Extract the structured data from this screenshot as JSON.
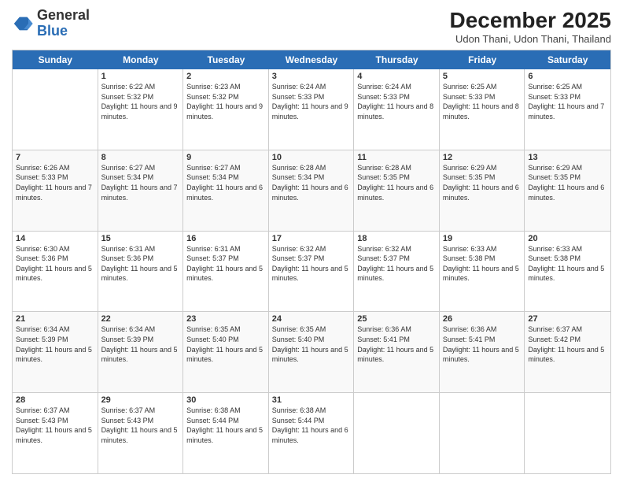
{
  "logo": {
    "general": "General",
    "blue": "Blue"
  },
  "header": {
    "month": "December 2025",
    "location": "Udon Thani, Udon Thani, Thailand"
  },
  "days": [
    "Sunday",
    "Monday",
    "Tuesday",
    "Wednesday",
    "Thursday",
    "Friday",
    "Saturday"
  ],
  "weeks": [
    [
      {
        "num": "",
        "sunrise": "",
        "sunset": "",
        "daylight": ""
      },
      {
        "num": "1",
        "sunrise": "6:22 AM",
        "sunset": "5:32 PM",
        "daylight": "11 hours and 9 minutes."
      },
      {
        "num": "2",
        "sunrise": "6:23 AM",
        "sunset": "5:32 PM",
        "daylight": "11 hours and 9 minutes."
      },
      {
        "num": "3",
        "sunrise": "6:24 AM",
        "sunset": "5:33 PM",
        "daylight": "11 hours and 9 minutes."
      },
      {
        "num": "4",
        "sunrise": "6:24 AM",
        "sunset": "5:33 PM",
        "daylight": "11 hours and 8 minutes."
      },
      {
        "num": "5",
        "sunrise": "6:25 AM",
        "sunset": "5:33 PM",
        "daylight": "11 hours and 8 minutes."
      },
      {
        "num": "6",
        "sunrise": "6:25 AM",
        "sunset": "5:33 PM",
        "daylight": "11 hours and 7 minutes."
      }
    ],
    [
      {
        "num": "7",
        "sunrise": "6:26 AM",
        "sunset": "5:33 PM",
        "daylight": "11 hours and 7 minutes."
      },
      {
        "num": "8",
        "sunrise": "6:27 AM",
        "sunset": "5:34 PM",
        "daylight": "11 hours and 7 minutes."
      },
      {
        "num": "9",
        "sunrise": "6:27 AM",
        "sunset": "5:34 PM",
        "daylight": "11 hours and 6 minutes."
      },
      {
        "num": "10",
        "sunrise": "6:28 AM",
        "sunset": "5:34 PM",
        "daylight": "11 hours and 6 minutes."
      },
      {
        "num": "11",
        "sunrise": "6:28 AM",
        "sunset": "5:35 PM",
        "daylight": "11 hours and 6 minutes."
      },
      {
        "num": "12",
        "sunrise": "6:29 AM",
        "sunset": "5:35 PM",
        "daylight": "11 hours and 6 minutes."
      },
      {
        "num": "13",
        "sunrise": "6:29 AM",
        "sunset": "5:35 PM",
        "daylight": "11 hours and 6 minutes."
      }
    ],
    [
      {
        "num": "14",
        "sunrise": "6:30 AM",
        "sunset": "5:36 PM",
        "daylight": "11 hours and 5 minutes."
      },
      {
        "num": "15",
        "sunrise": "6:31 AM",
        "sunset": "5:36 PM",
        "daylight": "11 hours and 5 minutes."
      },
      {
        "num": "16",
        "sunrise": "6:31 AM",
        "sunset": "5:37 PM",
        "daylight": "11 hours and 5 minutes."
      },
      {
        "num": "17",
        "sunrise": "6:32 AM",
        "sunset": "5:37 PM",
        "daylight": "11 hours and 5 minutes."
      },
      {
        "num": "18",
        "sunrise": "6:32 AM",
        "sunset": "5:37 PM",
        "daylight": "11 hours and 5 minutes."
      },
      {
        "num": "19",
        "sunrise": "6:33 AM",
        "sunset": "5:38 PM",
        "daylight": "11 hours and 5 minutes."
      },
      {
        "num": "20",
        "sunrise": "6:33 AM",
        "sunset": "5:38 PM",
        "daylight": "11 hours and 5 minutes."
      }
    ],
    [
      {
        "num": "21",
        "sunrise": "6:34 AM",
        "sunset": "5:39 PM",
        "daylight": "11 hours and 5 minutes."
      },
      {
        "num": "22",
        "sunrise": "6:34 AM",
        "sunset": "5:39 PM",
        "daylight": "11 hours and 5 minutes."
      },
      {
        "num": "23",
        "sunrise": "6:35 AM",
        "sunset": "5:40 PM",
        "daylight": "11 hours and 5 minutes."
      },
      {
        "num": "24",
        "sunrise": "6:35 AM",
        "sunset": "5:40 PM",
        "daylight": "11 hours and 5 minutes."
      },
      {
        "num": "25",
        "sunrise": "6:36 AM",
        "sunset": "5:41 PM",
        "daylight": "11 hours and 5 minutes."
      },
      {
        "num": "26",
        "sunrise": "6:36 AM",
        "sunset": "5:41 PM",
        "daylight": "11 hours and 5 minutes."
      },
      {
        "num": "27",
        "sunrise": "6:37 AM",
        "sunset": "5:42 PM",
        "daylight": "11 hours and 5 minutes."
      }
    ],
    [
      {
        "num": "28",
        "sunrise": "6:37 AM",
        "sunset": "5:43 PM",
        "daylight": "11 hours and 5 minutes."
      },
      {
        "num": "29",
        "sunrise": "6:37 AM",
        "sunset": "5:43 PM",
        "daylight": "11 hours and 5 minutes."
      },
      {
        "num": "30",
        "sunrise": "6:38 AM",
        "sunset": "5:44 PM",
        "daylight": "11 hours and 5 minutes."
      },
      {
        "num": "31",
        "sunrise": "6:38 AM",
        "sunset": "5:44 PM",
        "daylight": "11 hours and 6 minutes."
      },
      {
        "num": "",
        "sunrise": "",
        "sunset": "",
        "daylight": ""
      },
      {
        "num": "",
        "sunrise": "",
        "sunset": "",
        "daylight": ""
      },
      {
        "num": "",
        "sunrise": "",
        "sunset": "",
        "daylight": ""
      }
    ]
  ]
}
